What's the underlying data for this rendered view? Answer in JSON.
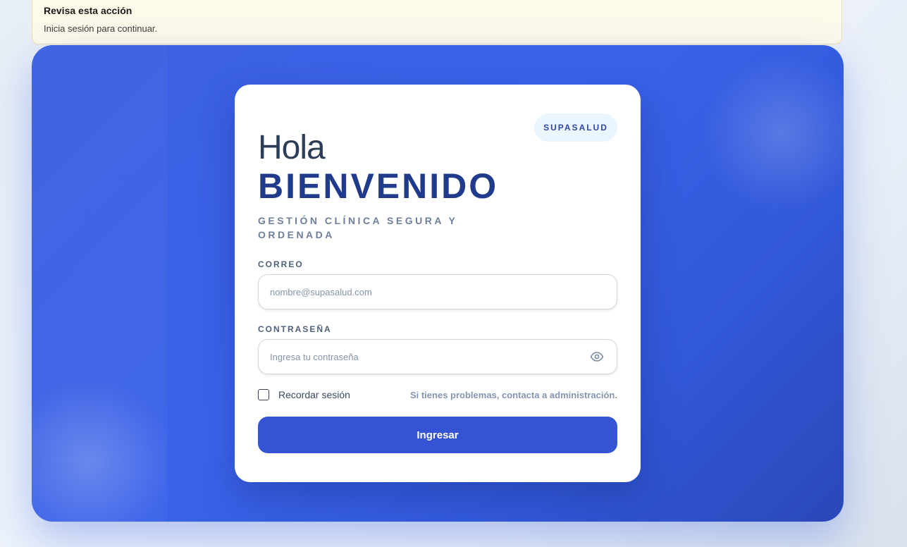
{
  "notice": {
    "title": "Revisa esta acción",
    "message": "Inicia sesión para continuar."
  },
  "login": {
    "brand": "SUPASALUD",
    "greeting": "Hola",
    "welcome": "BIENVENIDO",
    "subtitle": "GESTIÓN CLÍNICA SEGURA Y ORDENADA",
    "email": {
      "label": "CORREO",
      "placeholder": "nombre@supasalud.com",
      "value": ""
    },
    "password": {
      "label": "CONTRASEÑA",
      "placeholder": "Ingresa tu contraseña",
      "value": "",
      "toggle_icon": "eye-icon"
    },
    "remember": {
      "label": "Recordar sesión",
      "checked": false
    },
    "help_text": "Si tienes problemas, contacta a administración.",
    "submit_label": "Ingresar"
  },
  "colors": {
    "primary": "#3454d4",
    "hero_blue": "#3a63ea",
    "heading_dark_blue": "#203a8c",
    "notice_background": "#fefaea"
  }
}
